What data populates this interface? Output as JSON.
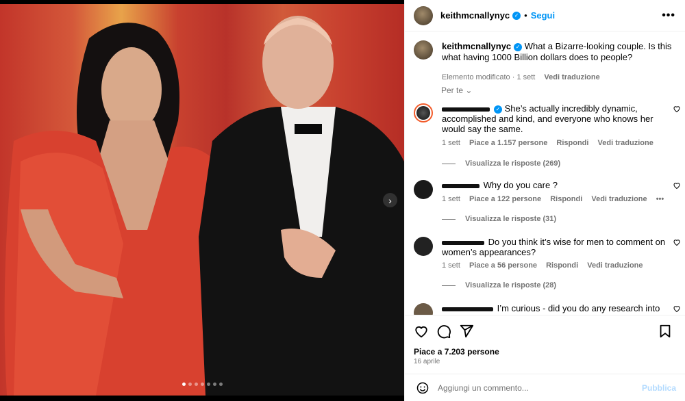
{
  "post": {
    "username": "keithmcnallynyc",
    "follow_label": "Segui",
    "separator": "•",
    "more_label": "•••",
    "caption_text": "What a Bizarre-looking couple. Is this what having 1000 Billion dollars does to people?",
    "caption_edited": "Elemento modificato",
    "caption_time": "1 sett",
    "caption_translate": "Vedi traduzione",
    "sort_label": "Per te",
    "carousel": {
      "slides": 7,
      "active_index": 0
    }
  },
  "comments": [
    {
      "text": "She’s actually incredibly dynamic, accomplished and kind, and everyone who knows her would say the same.",
      "time": "1 sett",
      "likes": "Piace a 1.157 persone",
      "reply": "Rispondi",
      "translate": "Vedi traduzione",
      "replies_label": "Visualizza le risposte (269)",
      "verified": true
    },
    {
      "text": "Why do you care ?",
      "time": "1 sett",
      "likes": "Piace a 122 persone",
      "reply": "Rispondi",
      "translate": "Vedi traduzione",
      "options": "•••",
      "replies_label": "Visualizza le risposte (31)"
    },
    {
      "text": "Do you think it’s wise for men to comment on women’s appearances?",
      "time": "1 sett",
      "likes": "Piace a 56 persone",
      "reply": "Rispondi",
      "translate": "Vedi traduzione",
      "replies_label": "Visualizza le risposte (28)"
    },
    {
      "text": "I’m curious - did you do any research into"
    }
  ],
  "actions": {
    "likes": "Piace a 7.203 persone",
    "date": "16 aprile"
  },
  "composer": {
    "placeholder": "Aggiungi un commento...",
    "post_label": "Pubblica"
  },
  "colors": {
    "accent": "#0095f6",
    "muted": "#737373",
    "post_disabled": "#b3dbff",
    "dress": "#c8412f"
  }
}
